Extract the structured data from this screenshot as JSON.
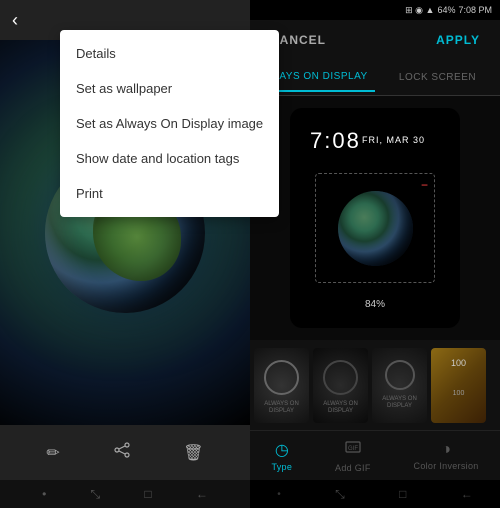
{
  "leftPanel": {
    "backArrow": "‹",
    "contextMenu": {
      "items": [
        "Details",
        "Set as wallpaper",
        "Set as Always On Display image",
        "Show date and location tags",
        "Print"
      ]
    },
    "bottomIcons": [
      "✏",
      "⟨⟩",
      "🗑"
    ],
    "navIcons": [
      "•",
      "⤡",
      "□",
      "←"
    ]
  },
  "rightPanel": {
    "statusBar": {
      "icons": "⊞ ⬛ ◉ ⟫",
      "signal": "64%",
      "time": "7:08 PM"
    },
    "actions": {
      "cancel": "CANCEL",
      "apply": "APPLY"
    },
    "tabs": [
      {
        "label": "ALWAYS ON DISPLAY",
        "active": true
      },
      {
        "label": "LOCK SCREEN",
        "active": false
      }
    ],
    "preview": {
      "time": "7:08",
      "date": "FRI, MAR 30",
      "battery": "84%"
    },
    "thumbnails": [
      {
        "label": "ALWAYS ON\nDISPLAY"
      },
      {
        "label": "ALWAYS ON\nDISPLAY"
      },
      {
        "label": "ALWAYS ON\nDISPLAY"
      },
      {
        "label": "100"
      }
    ],
    "bottomTabs": [
      {
        "icon": "◷",
        "label": "Type",
        "active": true
      },
      {
        "icon": "⊞",
        "label": "Add GIF",
        "active": false
      },
      {
        "icon": "◑",
        "label": "Color Inversion",
        "active": false
      }
    ],
    "navIcons": [
      "•",
      "⤡",
      "□",
      "←"
    ]
  }
}
